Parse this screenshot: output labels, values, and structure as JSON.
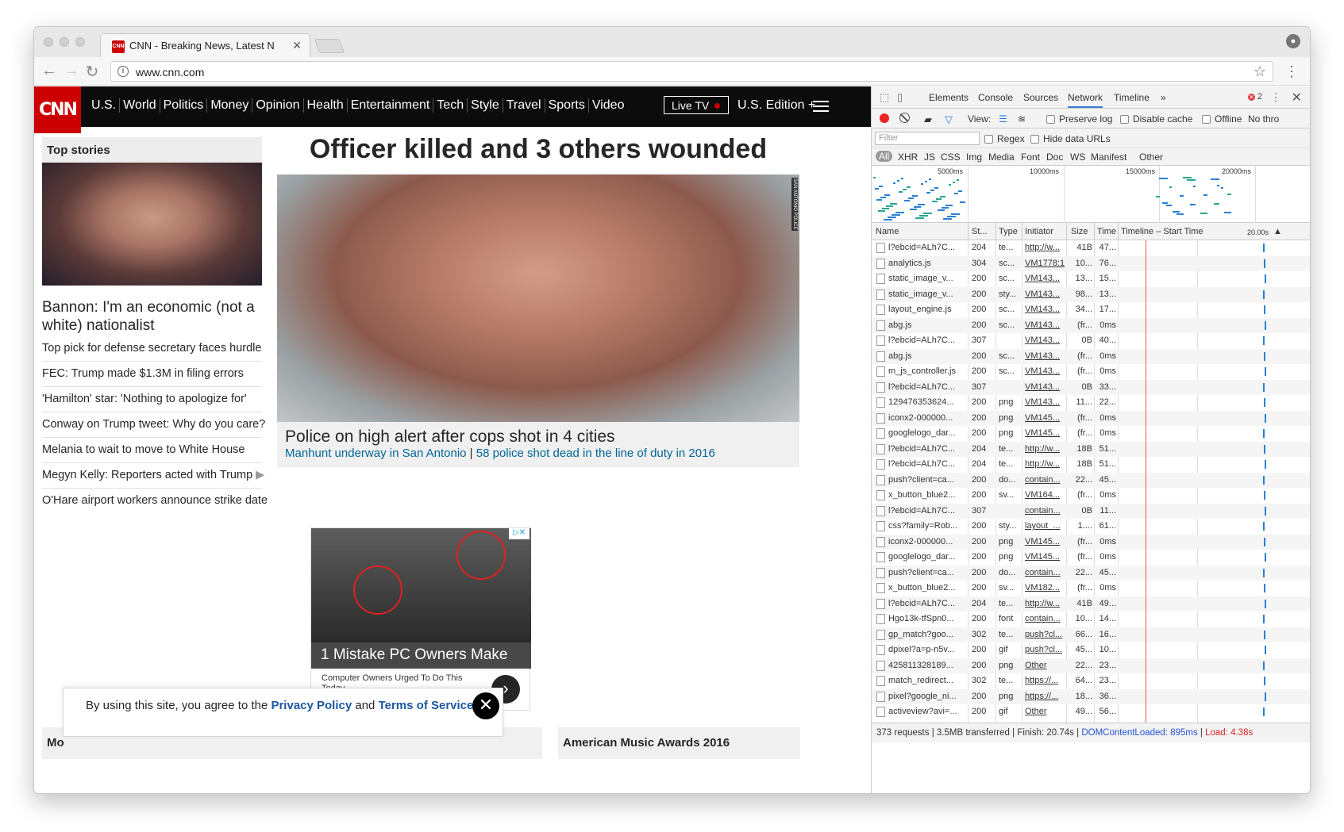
{
  "browser": {
    "tab_title": "CNN - Breaking News, Latest N",
    "favicon_text": "CNN",
    "url": "www.cnn.com"
  },
  "cnn": {
    "logo": "CNN",
    "nav": [
      "U.S.",
      "World",
      "Politics",
      "Money",
      "Opinion",
      "Health",
      "Entertainment",
      "Tech",
      "Style",
      "Travel",
      "Sports",
      "Video"
    ],
    "live_tv": "Live TV",
    "edition": "U.S. Edition +",
    "top_stories_label": "Top stories",
    "bannon_headline": "Bannon: I'm an economic (not a white) nationalist",
    "stories": [
      "Top pick for defense secretary faces hurdle",
      "FEC: Trump made $1.3M in filing errors",
      "'Hamilton' star: 'Nothing to apologize for'",
      "Conway on Trump tweet: Why do you care?",
      "Melania to wait to move to White House",
      "Megyn Kelly: Reporters acted with Trump",
      "O'Hare airport workers announce strike date"
    ],
    "main_headline": "Officer killed and 3 others wounded",
    "photo_credit": "SAN ANTONIO POLICE",
    "caption_title": "Police on high alert after cops shot in 4 cities",
    "caption_link1": "Manhunt underway in San Antonio",
    "caption_sep": "|",
    "caption_link2": "58 police shot dead in the line of duty in 2016",
    "ad_title": "1 Mistake PC Owners Make",
    "ad_sub": "Computer Owners Urged To Do This Today.",
    "section_left": "Mo",
    "section_right": "American Music Awards 2016",
    "cookie_text1": "By using this site, you agree to the ",
    "cookie_link1": "Privacy Policy",
    "cookie_text2": " and ",
    "cookie_link2": "Terms of Service",
    "cookie_text3": "."
  },
  "devtools": {
    "tabs": [
      "Elements",
      "Console",
      "Sources",
      "Network",
      "Timeline"
    ],
    "active_tab": "Network",
    "error_count": "2",
    "view_label": "View:",
    "preserve_log": "Preserve log",
    "disable_cache": "Disable cache",
    "offline": "Offline",
    "throttling": "No thro",
    "filter_placeholder": "Filter",
    "regex": "Regex",
    "hide_data_urls": "Hide data URLs",
    "type_filters": [
      "All",
      "XHR",
      "JS",
      "CSS",
      "Img",
      "Media",
      "Font",
      "Doc",
      "WS",
      "Manifest",
      "Other"
    ],
    "overview_ticks": [
      "5000ms",
      "10000ms",
      "15000ms",
      "20000ms"
    ],
    "columns": [
      "Name",
      "St...",
      "Type",
      "Initiator",
      "Size",
      "Time",
      "Timeline – Start Time",
      "20.00s"
    ],
    "rows": [
      [
        "l?ebcid=ALh7C...",
        "204",
        "te...",
        "http://w...",
        "41B",
        "47..."
      ],
      [
        "analytics.js",
        "304",
        "sc...",
        "VM1778:1",
        "10...",
        "76..."
      ],
      [
        "static_image_v...",
        "200",
        "sc...",
        "VM143...",
        "13...",
        "15..."
      ],
      [
        "static_image_v...",
        "200",
        "sty...",
        "VM143...",
        "98...",
        "13..."
      ],
      [
        "layout_engine.js",
        "200",
        "sc...",
        "VM143...",
        "34...",
        "17..."
      ],
      [
        "abg.js",
        "200",
        "sc...",
        "VM143...",
        "(fr...",
        "0ms"
      ],
      [
        "l?ebcid=ALh7C...",
        "307",
        "",
        "VM143...",
        "0B",
        "40..."
      ],
      [
        "abg.js",
        "200",
        "sc...",
        "VM143...",
        "(fr...",
        "0ms"
      ],
      [
        "m_js_controller.js",
        "200",
        "sc...",
        "VM143...",
        "(fr...",
        "0ms"
      ],
      [
        "l?ebcid=ALh7C...",
        "307",
        "",
        "VM143...",
        "0B",
        "33..."
      ],
      [
        "129476353624...",
        "200",
        "png",
        "VM143...",
        "11...",
        "22..."
      ],
      [
        "iconx2-000000...",
        "200",
        "png",
        "VM145...",
        "(fr...",
        "0ms"
      ],
      [
        "googlelogo_dar...",
        "200",
        "png",
        "VM145...",
        "(fr...",
        "0ms"
      ],
      [
        "l?ebcid=ALh7C...",
        "204",
        "te...",
        "http://w...",
        "18B",
        "51..."
      ],
      [
        "l?ebcid=ALh7C...",
        "204",
        "te...",
        "http://w...",
        "18B",
        "51..."
      ],
      [
        "push?client=ca...",
        "200",
        "do...",
        "contain...",
        "22...",
        "45..."
      ],
      [
        "x_button_blue2...",
        "200",
        "sv...",
        "VM164...",
        "(fr...",
        "0ms"
      ],
      [
        "l?ebcid=ALh7C...",
        "307",
        "",
        "contain...",
        "0B",
        "11..."
      ],
      [
        "css?family=Rob...",
        "200",
        "sty...",
        "layout_...",
        "1....",
        "61..."
      ],
      [
        "iconx2-000000...",
        "200",
        "png",
        "VM145...",
        "(fr...",
        "0ms"
      ],
      [
        "googlelogo_dar...",
        "200",
        "png",
        "VM145...",
        "(fr...",
        "0ms"
      ],
      [
        "push?client=ca...",
        "200",
        "do...",
        "contain...",
        "22...",
        "45..."
      ],
      [
        "x_button_blue2...",
        "200",
        "sv...",
        "VM182...",
        "(fr...",
        "0ms"
      ],
      [
        "l?ebcid=ALh7C...",
        "204",
        "te...",
        "http://w...",
        "41B",
        "49..."
      ],
      [
        "Hgo13k-tfSpn0...",
        "200",
        "font",
        "contain...",
        "10...",
        "14..."
      ],
      [
        "gp_match?goo...",
        "302",
        "te...",
        "push?cl...",
        "66...",
        "16..."
      ],
      [
        "dpixel?a=p-n5v...",
        "200",
        "gif",
        "push?cl...",
        "45...",
        "10..."
      ],
      [
        "425811328189...",
        "200",
        "png",
        "Other",
        "22...",
        "23..."
      ],
      [
        "match_redirect...",
        "302",
        "te...",
        "https://...",
        "64...",
        "23..."
      ],
      [
        "pixel?google_ni...",
        "200",
        "png",
        "https://...",
        "18...",
        "36..."
      ],
      [
        "activeview?avi=...",
        "200",
        "gif",
        "Other",
        "49...",
        "56..."
      ]
    ],
    "status": {
      "requests": "373 requests",
      "transferred": "3.5MB transferred",
      "finish": "Finish: 20.74s",
      "dom": "DOMContentLoaded: 895ms",
      "load": "Load: 4.38s"
    }
  }
}
